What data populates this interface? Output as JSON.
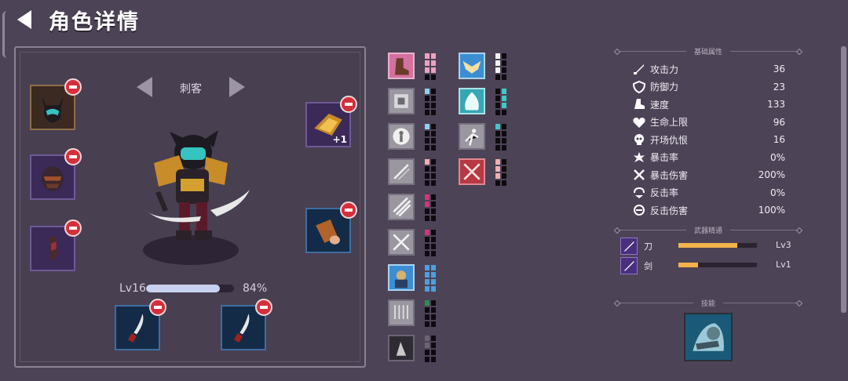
{
  "header": {
    "title": "角色详情"
  },
  "character": {
    "class_name": "刺客",
    "level_label": "Lv16",
    "level_progress_pct": 84,
    "level_pct_text": "84%",
    "gear_plus_text": "+1"
  },
  "skills_grid": {
    "col1": [
      {
        "icon": "boots-icon",
        "style": "pink",
        "pips": [
          "#f0a0c0",
          "#f0a0c0",
          "#f0a0c0",
          "#f0a0c0",
          "#f0a0c0",
          "#f0a0c0",
          "#0e0b10",
          "#0e0b10"
        ]
      },
      {
        "icon": "plate-armor-icon",
        "style": "grey",
        "pips": [
          "#8fd0f0",
          "#0e0b10",
          "#0e0b10",
          "#0e0b10",
          "#0e0b10",
          "#0e0b10",
          "#0e0b10",
          "#0e0b10"
        ]
      },
      {
        "icon": "body-target-icon",
        "style": "grey",
        "pips": [
          "#8fd0f0",
          "#0e0b10",
          "#0e0b10",
          "#0e0b10",
          "#0e0b10",
          "#0e0b10",
          "#0e0b10",
          "#0e0b10"
        ]
      },
      {
        "icon": "blades-icon",
        "style": "grey",
        "pips": [
          "#f0b0b0",
          "#0e0b10",
          "#0e0b10",
          "#0e0b10",
          "#0e0b10",
          "#0e0b10",
          "#0e0b10",
          "#0e0b10"
        ]
      },
      {
        "icon": "claw-slash-icon",
        "style": "grey",
        "pips": [
          "#c83a7a",
          "#0e0b10",
          "#c83a7a",
          "#0e0b10",
          "#0e0b10",
          "#0e0b10",
          "#0e0b10",
          "#0e0b10"
        ]
      },
      {
        "icon": "crossed-swords-icon",
        "style": "grey",
        "pips": [
          "#c83a7a",
          "#0e0b10",
          "#0e0b10",
          "#0e0b10",
          "#0e0b10",
          "#0e0b10",
          "#0e0b10",
          "#0e0b10"
        ]
      },
      {
        "icon": "warrior-portrait-icon",
        "style": "sky",
        "pips": [
          "#4aa0e0",
          "#4aa0e0",
          "#4aa0e0",
          "#4aa0e0",
          "#4aa0e0",
          "#4aa0e0",
          "#4aa0e0",
          "#4aa0e0"
        ]
      },
      {
        "icon": "rain-icon",
        "style": "grey",
        "pips": [
          "#2f8a55",
          "#0e0b10",
          "#0e0b10",
          "#0e0b10",
          "#0e0b10",
          "#0e0b10",
          "#0e0b10",
          "#0e0b10"
        ]
      },
      {
        "icon": "dark-figure-icon",
        "style": "dark",
        "pips": [
          "#6a6572",
          "#0e0b10",
          "#6a6572",
          "#0e0b10",
          "#0e0b10",
          "#0e0b10",
          "#0e0b10",
          "#0e0b10"
        ]
      }
    ],
    "col2": [
      {
        "icon": "winged-emblem-icon",
        "style": "sky",
        "pips": [
          "#0e0b10",
          "#0e0b10",
          "#0e0b10",
          "#0e0b10",
          "#0e0b10",
          "#0e0b10",
          "#0e0b10",
          "#0e0b10"
        ],
        "lightpips": [
          0,
          2,
          4
        ]
      },
      {
        "icon": "spirit-icon",
        "style": "teal",
        "pips": [
          "#0e0b10",
          "#40c8c8",
          "#0e0b10",
          "#40c8c8",
          "#0e0b10",
          "#40c8c8",
          "#0e0b10",
          "#0e0b10"
        ]
      },
      {
        "icon": "dodge-figure-icon",
        "style": "grey",
        "pips": [
          "#40c8c8",
          "#0e0b10",
          "#0e0b10",
          "#0e0b10",
          "#0e0b10",
          "#0e0b10",
          "#0e0b10",
          "#0e0b10"
        ]
      },
      {
        "icon": "counter-blades-icon",
        "style": "red",
        "pips": [
          "#f0b0b0",
          "#0e0b10",
          "#f0b0b0",
          "#0e0b10",
          "#f0b0b0",
          "#0e0b10",
          "#0e0b10",
          "#0e0b10"
        ]
      }
    ]
  },
  "stats": {
    "section_title": "基础属性",
    "rows": [
      {
        "icon": "sword-icon",
        "name": "攻击力",
        "value": "36"
      },
      {
        "icon": "shield-icon",
        "name": "防御力",
        "value": "23"
      },
      {
        "icon": "boot-icon",
        "name": "速度",
        "value": "133"
      },
      {
        "icon": "heart-icon",
        "name": "生命上限",
        "value": "96"
      },
      {
        "icon": "skull-icon",
        "name": "开场仇恨",
        "value": "16"
      },
      {
        "icon": "burst-icon",
        "name": "暴击率",
        "value": "0%"
      },
      {
        "icon": "crossed-burst-icon",
        "name": "暴击伤害",
        "value": "200%"
      },
      {
        "icon": "counter-icon",
        "name": "反击率",
        "value": "0%"
      },
      {
        "icon": "counter-damage-icon",
        "name": "反击伤害",
        "value": "100%"
      }
    ]
  },
  "mastery": {
    "section_title": "武器精通",
    "rows": [
      {
        "icon": "blade-weapon-icon",
        "name": "刀",
        "progress": 0.75,
        "level": "Lv3"
      },
      {
        "icon": "sword-weapon-icon",
        "name": "剑",
        "progress": 0.25,
        "level": "Lv1"
      }
    ]
  },
  "talent": {
    "section_title": "技能",
    "icon": "frost-knight-skill-icon"
  }
}
